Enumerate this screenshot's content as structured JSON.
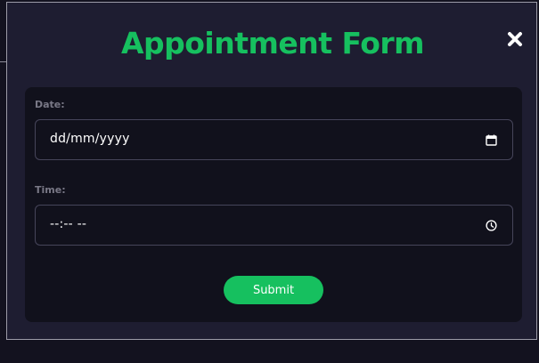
{
  "modal": {
    "title": "Appointment Form",
    "close_icon": "close-x-icon"
  },
  "form": {
    "date_label": "Date:",
    "date_value": "dd/mm/yyyy",
    "date_icon": "calendar-icon",
    "time_label": "Time:",
    "time_value": "--:-- --",
    "time_icon": "clock-icon",
    "submit_label": "Submit"
  },
  "colors": {
    "accent": "#16c05f",
    "page_background": "#13121f",
    "modal_background": "#1e1d31",
    "form_background": "#11111c",
    "label_text": "#797886",
    "field_border": "#46455a"
  }
}
